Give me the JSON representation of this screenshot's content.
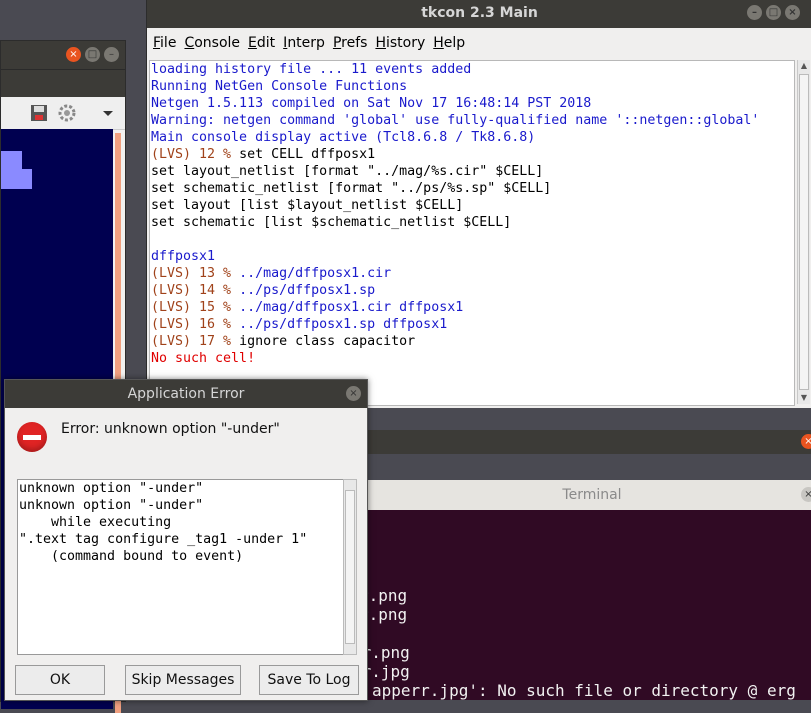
{
  "tkcon": {
    "title": "tkcon 2.3 Main",
    "menu": [
      "File",
      "Console",
      "Edit",
      "Interp",
      "Prefs",
      "History",
      "Help"
    ],
    "lines": [
      {
        "parts": [
          {
            "t": "loading history file ... 11 events added",
            "c": "blue"
          }
        ]
      },
      {
        "parts": [
          {
            "t": "Running NetGen Console Functions",
            "c": "blue"
          }
        ]
      },
      {
        "parts": [
          {
            "t": "Netgen 1.5.113 compiled on Sat Nov 17 16:48:14 PST 2018",
            "c": "blue"
          }
        ]
      },
      {
        "parts": [
          {
            "t": "Warning: netgen command 'global' use fully-qualified name '::netgen::global'",
            "c": "blue"
          }
        ]
      },
      {
        "parts": [
          {
            "t": "Main console display active (Tcl8.6.8 / Tk8.6.8)",
            "c": "blue"
          }
        ]
      },
      {
        "parts": [
          {
            "t": "(LVS) 12 % ",
            "c": "brown"
          },
          {
            "t": "set CELL dffposx1",
            "c": "black"
          }
        ]
      },
      {
        "parts": [
          {
            "t": "set layout_netlist [format \"../mag/%s.cir\" $CELL]",
            "c": "black"
          }
        ]
      },
      {
        "parts": [
          {
            "t": "set schematic_netlist [format \"../ps/%s.sp\" $CELL]",
            "c": "black"
          }
        ]
      },
      {
        "parts": [
          {
            "t": "set layout [list $layout_netlist $CELL]",
            "c": "black"
          }
        ]
      },
      {
        "parts": [
          {
            "t": "set schematic [list $schematic_netlist $CELL]",
            "c": "black"
          }
        ]
      },
      {
        "parts": [
          {
            "t": "",
            "c": "black"
          }
        ]
      },
      {
        "parts": [
          {
            "t": "dffposx1",
            "c": "blue"
          }
        ]
      },
      {
        "parts": [
          {
            "t": "(LVS) 13 % ",
            "c": "brown"
          },
          {
            "t": "../mag/dffposx1.cir",
            "c": "blue"
          }
        ]
      },
      {
        "parts": [
          {
            "t": "(LVS) 14 % ",
            "c": "brown"
          },
          {
            "t": "../ps/dffposx1.sp",
            "c": "blue"
          }
        ]
      },
      {
        "parts": [
          {
            "t": "(LVS) 15 % ",
            "c": "brown"
          },
          {
            "t": "../mag/dffposx1.cir dffposx1",
            "c": "blue"
          }
        ]
      },
      {
        "parts": [
          {
            "t": "(LVS) 16 % ",
            "c": "brown"
          },
          {
            "t": "../ps/dffposx1.sp dffposx1",
            "c": "blue"
          }
        ]
      },
      {
        "parts": [
          {
            "t": "(LVS) 17 % ",
            "c": "brown"
          },
          {
            "t": "ignore class capacitor",
            "c": "black"
          }
        ]
      },
      {
        "parts": [
          {
            "t": "No such cell!",
            "c": "red"
          }
        ]
      }
    ]
  },
  "error_dialog": {
    "title": "Application Error",
    "message": "Error: unknown option \"-under\"",
    "details": [
      "unknown option \"-under\"",
      "unknown option \"-under\"",
      "    while executing",
      "\".text tag configure _tag1 -under 1\"",
      "    (command bound to event)"
    ],
    "buttons": {
      "ok": "OK",
      "skip": "Skip Messages",
      "save": "Save To Log"
    }
  },
  "terminal": {
    "title": "Terminal",
    "lines": [
      "",
      "",
      "",
      "",
      "r.png",
      "r.png",
      "",
      "rr.png",
      "rr.jpg",
      "apperr.jpg': No such file or directory @ erg"
    ]
  },
  "colors": {
    "blue": "#1a1acc",
    "red": "#e00000",
    "brown": "#a0421a",
    "black": "#000000"
  }
}
